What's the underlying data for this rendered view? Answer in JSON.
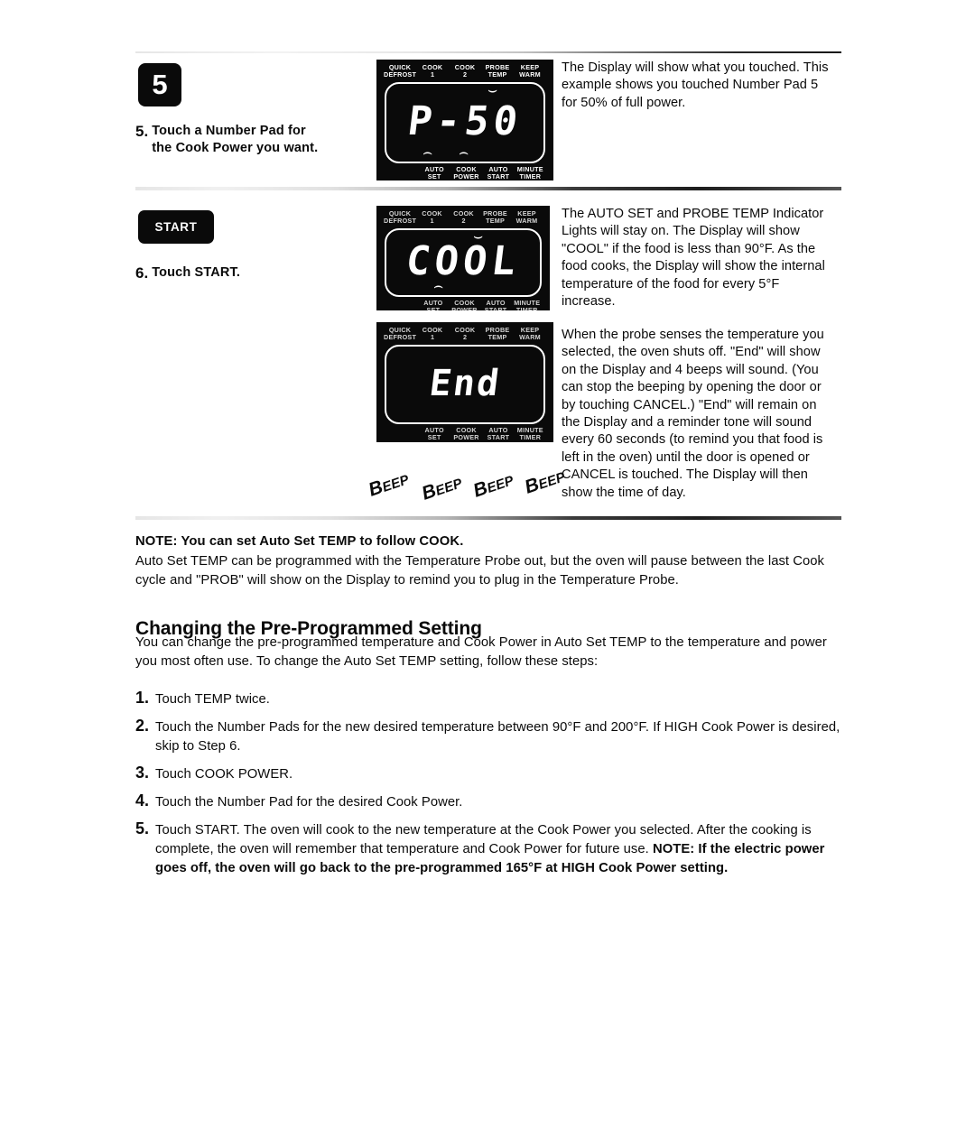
{
  "page": {
    "rules": [
      "divider-top",
      "divider-mid",
      "divider-lower"
    ]
  },
  "steps_top": [
    {
      "badge": "5",
      "number": "5.",
      "text": "Touch a Number Pad for\nthe Cook Power you want.",
      "panel": {
        "top_labels": [
          "QUICK\nDEFROST",
          "COOK\n1",
          "COOK\n2",
          "PROBE\nTEMP",
          "KEEP\nWARM"
        ],
        "display": "P-50",
        "bottom_labels": [
          "AUTO\nSET",
          "COOK\nPOWER",
          "AUTO\nSTART",
          "MINUTE\nTIMER"
        ]
      },
      "description": "The Display will show what you touched. This example shows you touched Number Pad 5 for 50% of full power."
    },
    {
      "badge": "START",
      "number": "6.",
      "text": "Touch START.",
      "panel": {
        "top_labels": [
          "QUICK\nDEFROST",
          "COOK\n1",
          "COOK\n2",
          "PROBE\nTEMP",
          "KEEP\nWARM"
        ],
        "display": "COOL",
        "bottom_labels": [
          "AUTO\nSET",
          "COOK\nPOWER",
          "AUTO\nSTART",
          "MINUTE\nTIMER"
        ]
      },
      "description": "The AUTO SET and PROBE TEMP Indicator Lights will stay on. The Display will show \"COOL\" if the food is less than 90°F. As the food cooks, the Display will show the internal temperature of the food for every 5°F increase."
    }
  ],
  "end_block": {
    "panel": {
      "top_labels": [
        "QUICK\nDEFROST",
        "COOK\n1",
        "COOK\n2",
        "PROBE\nTEMP",
        "KEEP\nWARM"
      ],
      "display": "End",
      "bottom_labels": [
        "AUTO\nSET",
        "COOK\nPOWER",
        "AUTO\nSTART",
        "MINUTE\nTIMER"
      ]
    },
    "beeps": [
      "BEEP",
      "BEEP",
      "BEEP",
      "BEEP"
    ],
    "description": "When the probe senses the temperature you selected, the oven shuts off. \"End\" will show on the Display and 4 beeps will sound. (You can stop the beeping by opening the door or by touching CANCEL.) \"End\" will remain on the Display and a reminder tone will sound every 60 seconds (to remind you that food is left in the oven) until the door is opened or CANCEL is touched. The Display will then show the time of day."
  },
  "note": {
    "heading": "NOTE: You can set Auto Set TEMP to follow COOK.",
    "body": "Auto Set TEMP can be programmed with the Temperature Probe out, but the oven will pause between the last Cook cycle and \"PROB\" will show on the Display to remind you to plug in the Temperature Probe."
  },
  "section": {
    "heading": "Changing the Pre-Programmed Setting",
    "intro": "You can change the pre-programmed temperature and Cook Power in Auto Set TEMP to the temperature and power you most often use. To change the Auto Set TEMP setting, follow these steps:",
    "steps": [
      {
        "num": "1.",
        "text": "Touch TEMP twice."
      },
      {
        "num": "2.",
        "text": "Touch the Number Pads for the new desired temperature between 90°F and 200°F. If HIGH Cook Power is desired, skip to Step 6."
      },
      {
        "num": "3.",
        "text": "Touch COOK POWER."
      },
      {
        "num": "4.",
        "text": "Touch the Number Pad for the desired Cook Power."
      },
      {
        "num": "5.",
        "text_plain": "Touch START. The oven will cook to the new temperature at the Cook Power you selected. After the cooking is complete, the oven will remember that temperature and Cook Power for future use. ",
        "text_bold": "NOTE: If the electric power goes off, the oven will go back to the pre-programmed 165°F at HIGH Cook Power setting."
      }
    ]
  }
}
